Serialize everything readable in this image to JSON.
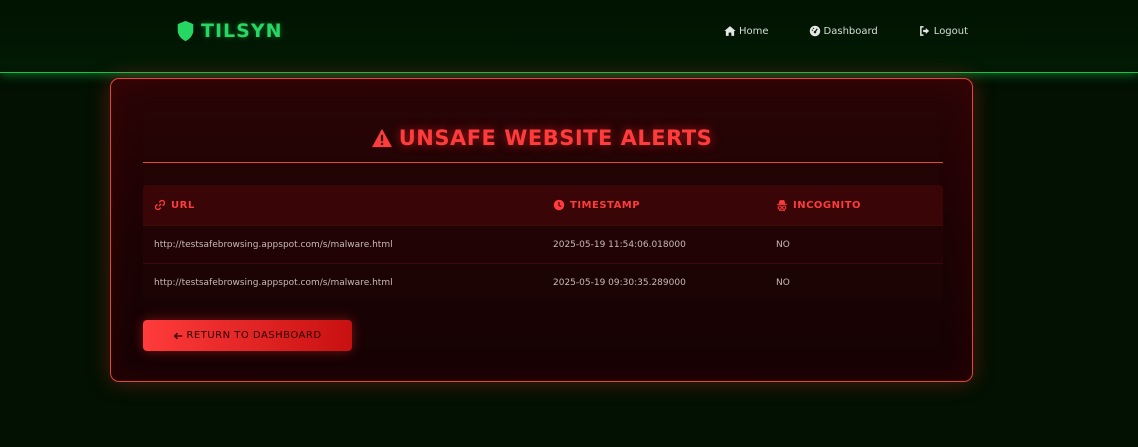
{
  "nav": {
    "brand": "TILSYN",
    "links": [
      {
        "label": "Home",
        "icon": "home-icon"
      },
      {
        "label": "Dashboard",
        "icon": "dashboard-icon"
      },
      {
        "label": "Logout",
        "icon": "logout-icon"
      }
    ]
  },
  "panel": {
    "title": "UNSAFE WEBSITE ALERTS",
    "title_icon": "warning-icon",
    "columns": [
      {
        "label": "URL",
        "icon": "link-icon"
      },
      {
        "label": "TIMESTAMP",
        "icon": "clock-icon"
      },
      {
        "label": "INCOGNITO",
        "icon": "incognito-icon"
      }
    ],
    "rows": [
      {
        "url": "http://testsafebrowsing.appspot.com/s/malware.html",
        "timestamp": "2025-05-19 11:54:06.018000",
        "incognito": "NO"
      },
      {
        "url": "http://testsafebrowsing.appspot.com/s/malware.html",
        "timestamp": "2025-05-19 09:30:35.289000",
        "incognito": "NO"
      }
    ],
    "return_button": "RETURN TO DASHBOARD"
  },
  "colors": {
    "background": "#021102",
    "brand_green": "#27d763",
    "alert_red": "#ff3b3b",
    "panel_border": "#e0453f"
  }
}
